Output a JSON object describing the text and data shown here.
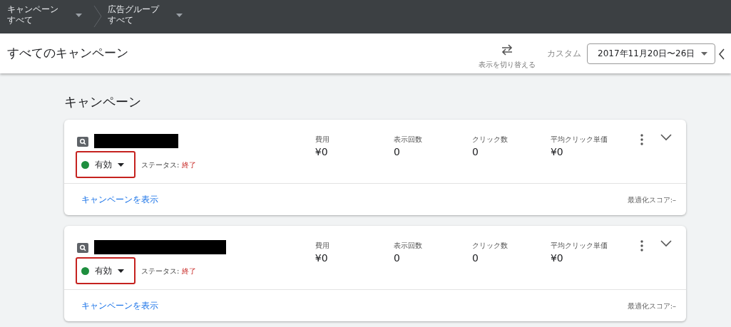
{
  "breadcrumbs": [
    {
      "label": "キャンペーン",
      "value": "すべて"
    },
    {
      "label": "広告グループ",
      "value": "すべて"
    }
  ],
  "header": {
    "title": "すべてのキャンペーン",
    "toggle_label": "表示を切り替える",
    "range_label": "カスタム",
    "date_range": "2017年11月20日〜26日"
  },
  "section_title": "キャンペーン",
  "campaigns": [
    {
      "status": "有効",
      "color": "#1e8e3e",
      "highlighted": true,
      "status_label": "ステータス:",
      "status_value": "終了",
      "metrics": [
        {
          "label": "費用",
          "value": "¥0"
        },
        {
          "label": "表示回数",
          "value": "0"
        },
        {
          "label": "クリック数",
          "value": "0"
        },
        {
          "label": "平均クリック単価",
          "value": "¥0"
        }
      ],
      "link": "キャンペーンを表示",
      "score": "最適化スコア:–"
    },
    {
      "status": "有効",
      "color": "#1e8e3e",
      "highlighted": true,
      "status_label": "ステータス:",
      "status_value": "終了",
      "metrics": [
        {
          "label": "費用",
          "value": "¥0"
        },
        {
          "label": "表示回数",
          "value": "0"
        },
        {
          "label": "クリック数",
          "value": "0"
        },
        {
          "label": "平均クリック単価",
          "value": "¥0"
        }
      ],
      "link": "キャンペーンを表示",
      "score": "最適化スコア:–"
    }
  ]
}
